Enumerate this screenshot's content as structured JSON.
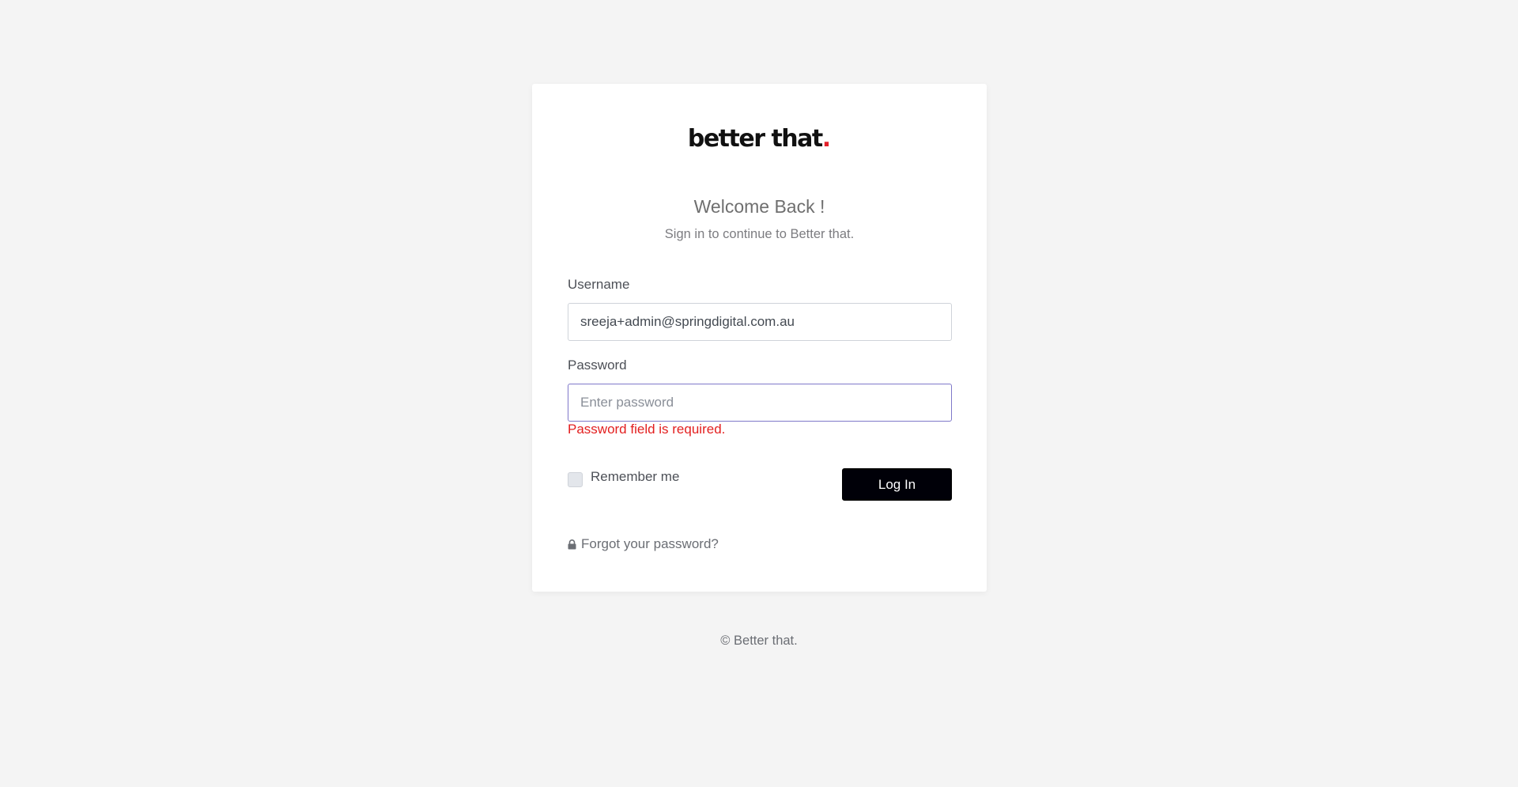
{
  "brand": {
    "logo_text": "better that",
    "logo_dot": ".",
    "logo_dot_color": "#e3212b"
  },
  "header": {
    "title": "Welcome Back !",
    "subtitle": "Sign in to continue to Better that."
  },
  "form": {
    "username_label": "Username",
    "username_value": "sreeja+admin@springdigital.com.au",
    "password_label": "Password",
    "password_value": "",
    "password_placeholder": "Enter password",
    "password_error": "Password field is required.",
    "remember_label": "Remember me",
    "remember_checked": false,
    "login_label": "Log In",
    "forgot_label": "Forgot your password?",
    "forgot_icon": "lock-icon"
  },
  "footer": {
    "copyright": "© Better that."
  },
  "colors": {
    "background": "#f4f4f4",
    "error": "#e31f1f",
    "button": "#000008",
    "focus_border": "#7f78c9"
  }
}
